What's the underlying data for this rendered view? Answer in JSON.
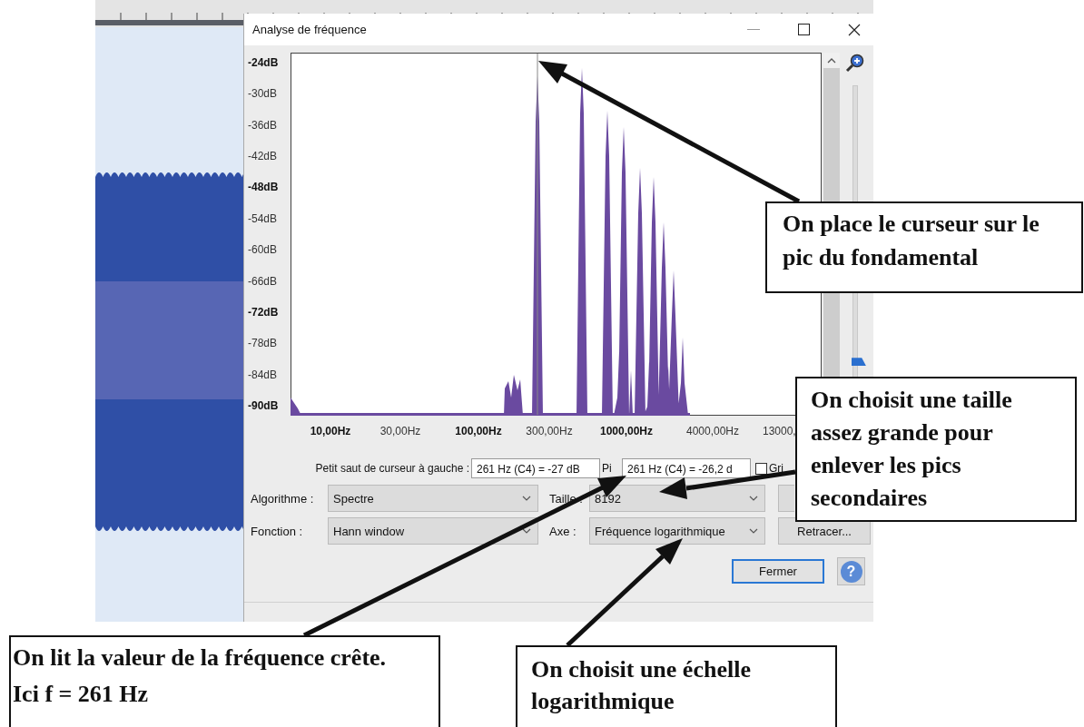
{
  "window": {
    "title": "Analyse de fréquence"
  },
  "plot": {
    "y_ticks": [
      {
        "label": "-24dB",
        "major": true
      },
      {
        "label": "-30dB",
        "major": false
      },
      {
        "label": "-36dB",
        "major": false
      },
      {
        "label": "-42dB",
        "major": false
      },
      {
        "label": "-48dB",
        "major": true
      },
      {
        "label": "-54dB",
        "major": false
      },
      {
        "label": "-60dB",
        "major": false
      },
      {
        "label": "-66dB",
        "major": false
      },
      {
        "label": "-72dB",
        "major": true
      },
      {
        "label": "-78dB",
        "major": false
      },
      {
        "label": "-84dB",
        "major": false
      },
      {
        "label": "-90dB",
        "major": true
      }
    ],
    "x_ticks": [
      {
        "label": "10,00Hz",
        "major": true
      },
      {
        "label": "30,00Hz",
        "major": false
      },
      {
        "label": "100,00Hz",
        "major": true
      },
      {
        "label": "300,00Hz",
        "major": false
      },
      {
        "label": "1000,00Hz",
        "major": true
      },
      {
        "label": "4000,00Hz",
        "major": false
      },
      {
        "label": "13000,",
        "major": false
      }
    ]
  },
  "zoom_slider": {
    "level": 0.12
  },
  "cursor_row": {
    "label": "Petit saut de curseur à gauche :",
    "cursor_value": "261 Hz (C4) = -27 dB",
    "peak_label": "Pi",
    "peak_value": "261 Hz (C4) = -26,2 d",
    "grid_label": "Gri",
    "grid_checked": false
  },
  "settings_rows": [
    {
      "label": "Algorithme :",
      "value": "Spectre",
      "label2": "Taille :",
      "value2": "8192"
    },
    {
      "label": "Fonction :",
      "value": "Hann window",
      "label2": "Axe :",
      "value2": "Fréquence logarithmique",
      "button": "Retracer..."
    }
  ],
  "buttons": {
    "close": "Fermer",
    "help": "?"
  },
  "callouts": [
    {
      "text": "On place le curseur sur le\npic du fondamental"
    },
    {
      "text": "On choisit une taille\nassez grande pour\nenlever les pics\nsecondaires"
    },
    {
      "text": "On lit la valeur de la fréquence crête.\nIci f = 261 Hz"
    },
    {
      "text": "On choisit une échelle\nlogarithmique"
    }
  ]
}
